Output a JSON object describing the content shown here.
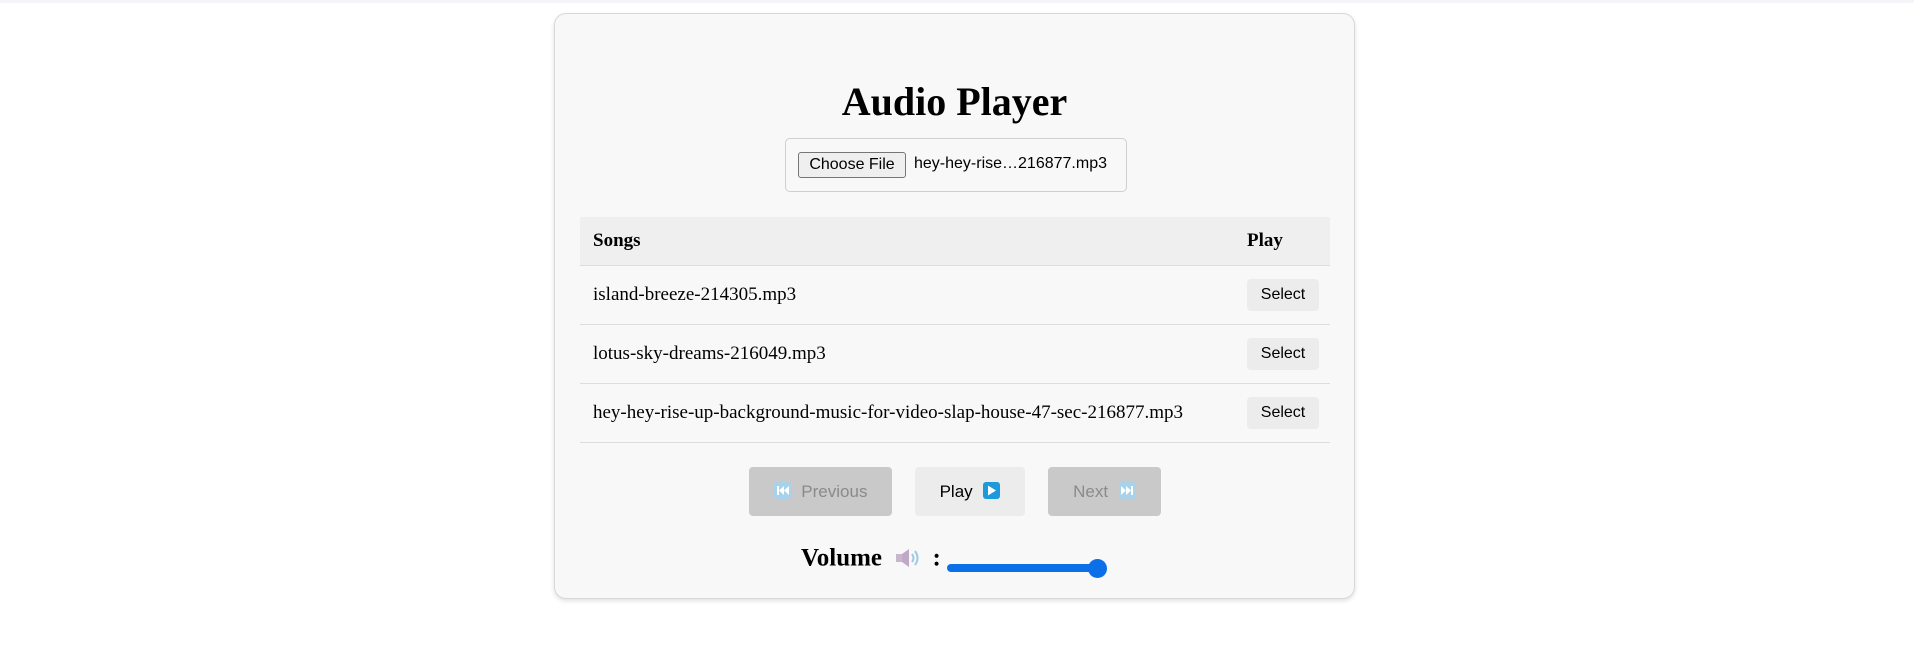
{
  "app": {
    "title": "Audio Player"
  },
  "file_input": {
    "button_label": "Choose File",
    "selected_file": "hey-hey-rise…216877.mp3"
  },
  "table": {
    "headers": {
      "songs": "Songs",
      "play": "Play"
    },
    "rows": [
      {
        "song": "island-breeze-214305.mp3",
        "action": "Select"
      },
      {
        "song": "lotus-sky-dreams-216049.mp3",
        "action": "Select"
      },
      {
        "song": "hey-hey-rise-up-background-music-for-video-slap-house-47-sec-216877.mp3",
        "action": "Select"
      }
    ]
  },
  "controls": {
    "previous": {
      "label": "Previous",
      "icon": "previous-track-icon",
      "disabled": true
    },
    "play": {
      "label": "Play",
      "icon": "play-icon",
      "disabled": false
    },
    "next": {
      "label": "Next",
      "icon": "next-track-icon",
      "disabled": true
    }
  },
  "volume": {
    "label": "Volume",
    "icon": "speaker-icon",
    "separator": ":",
    "level": 1.0
  },
  "colors": {
    "accent": "#0b6fe8",
    "media_icon": "#1d9ad9",
    "disabled_button": "#c9c9c9",
    "card_background": "#f8f8f8"
  }
}
